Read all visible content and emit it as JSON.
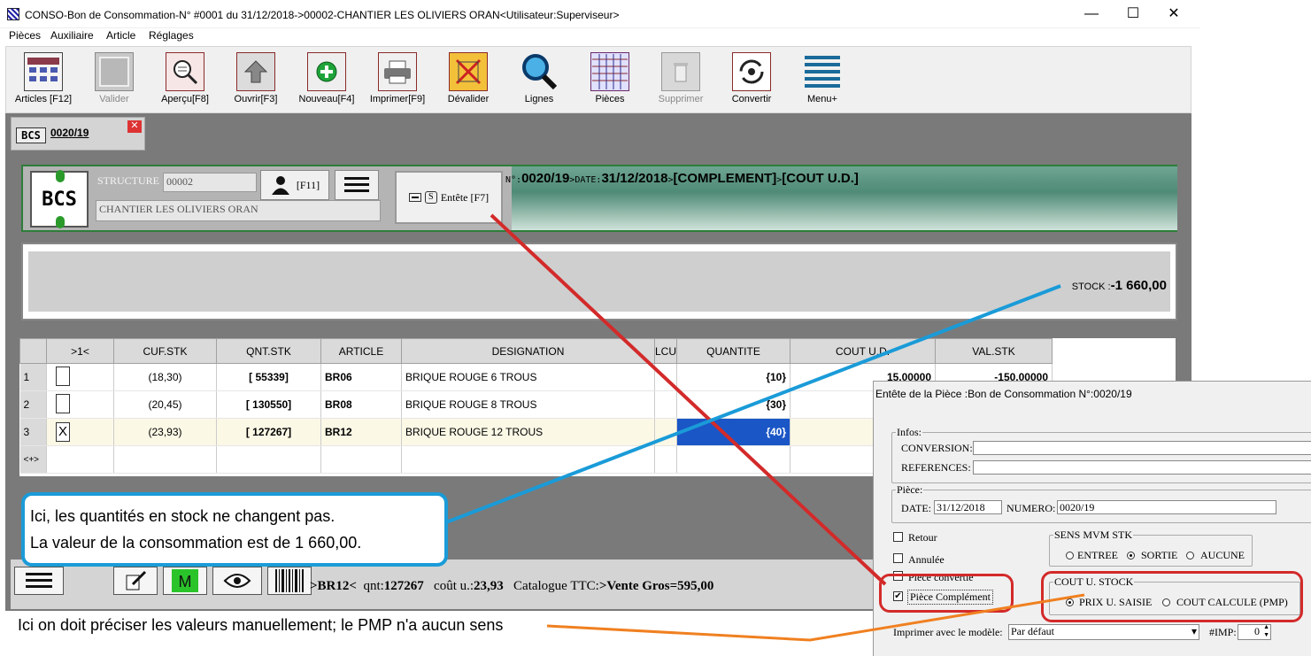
{
  "window": {
    "title": "CONSO-Bon de Consommation-N° #0001 du 31/12/2018->00002-CHANTIER LES OLIVIERS ORAN<Utilisateur:Superviseur>",
    "minimize": "—",
    "maximize": "☐",
    "close": "✕"
  },
  "menu": [
    "Pièces",
    "Auxiliaire",
    "Article",
    "Réglages"
  ],
  "toolbar": [
    {
      "label": "Articles [F12]",
      "icon": "articles-grid-icon",
      "enabled": true
    },
    {
      "label": "Valider",
      "icon": "validate-icon",
      "enabled": false
    },
    {
      "label": "Aperçu[F8]",
      "icon": "preview-magnifier-icon",
      "enabled": true
    },
    {
      "label": "Ouvrir[F3]",
      "icon": "open-arrow-icon",
      "enabled": true
    },
    {
      "label": "Nouveau[F4]",
      "icon": "new-plus-icon",
      "enabled": true
    },
    {
      "label": "Imprimer[F9]",
      "icon": "printer-icon",
      "enabled": true
    },
    {
      "label": "Dévalider",
      "icon": "devalidate-icon",
      "enabled": true
    },
    {
      "label": "Lignes",
      "icon": "lines-search-icon",
      "enabled": true
    },
    {
      "label": "Pièces",
      "icon": "pieces-grid-icon",
      "enabled": true
    },
    {
      "label": "Supprimer",
      "icon": "delete-bin-icon",
      "enabled": false
    },
    {
      "label": "Convertir",
      "icon": "convert-cycle-icon",
      "enabled": true
    },
    {
      "label": "Menu+",
      "icon": "menu-lines-icon",
      "enabled": true
    }
  ],
  "tab": {
    "code": "BCS",
    "title": "0020/19",
    "close": "✕"
  },
  "header": {
    "logo": "BCS",
    "structure_label": "STRUCTURE",
    "structure_code": "00002",
    "structure_name": "CHANTIER LES OLIVIERS ORAN",
    "user_key": "[F11]",
    "entete_icon": "S",
    "entete_label": "Entête [F7]",
    "no_label": "N°:",
    "no_value": "0020/19",
    "date_label": "DATE:",
    "date_value": "31/12/2018",
    "tag1": "[COMPLEMENT]",
    "tag2": "[COUT U.D.]"
  },
  "stock": {
    "label": "STOCK :",
    "value": "-1 660,00"
  },
  "grid": {
    "columns": [
      ">1<",
      "CUF.STK",
      "QNT.STK",
      "ARTICLE",
      "DESIGNATION",
      "LCU",
      "QUANTITE",
      "COUT U.D.",
      "VAL.STK"
    ],
    "rows": [
      {
        "n": "1",
        "mark": "",
        "cuf": "(18,30)",
        "qnt": "[ 55339]",
        "article": "BR06",
        "designation": "BRIQUE ROUGE 6 TROUS",
        "quantite": "{10}",
        "cout": "15,00000",
        "val": "-150,00000"
      },
      {
        "n": "2",
        "mark": "",
        "cuf": "(20,45)",
        "qnt": "[ 130550]",
        "article": "BR08",
        "designation": "BRIQUE ROUGE 8 TROUS",
        "quantite": "{30}",
        "cout": "",
        "val": ""
      },
      {
        "n": "3",
        "mark": "X",
        "cuf": "(23,93)",
        "qnt": "[ 127267]",
        "article": "BR12",
        "designation": "BRIQUE ROUGE 12 TROUS",
        "quantite": "{40}",
        "cout": "",
        "val": ""
      }
    ],
    "new_row": "<+>"
  },
  "annotations": {
    "blue_line1": "Ici, les quantités en stock   ne changent pas.",
    "blue_line2": "La valeur de la consommation est de 1 660,00.",
    "bottom_note": "Ici on doit préciser les valeurs manuellement; le PMP n'a aucun sens"
  },
  "status": {
    "article": ">BR12<",
    "qnt_label": "qnt:",
    "qnt": "127267",
    "cout_label": "coût u.:",
    "cout": "23,93",
    "catalogue": "Catalogue TTC:",
    "vente": ">Vente Gros=595,00"
  },
  "dialog": {
    "title": "Entête de la Pièce :Bon de Consommation N°:0020/19",
    "infos": "Infos:",
    "conversion": "CONVERSION:",
    "references": "REFERENCES:",
    "piece": "Pièce:",
    "date_label": "DATE:",
    "date": "31/12/2018",
    "numero_label": "NUMERO:",
    "numero": "0020/19",
    "retour": "Retour",
    "annulee": "Annulée",
    "convertie": "Pièce convertie",
    "complement": "Pièce Complément",
    "sens_title": "SENS MVM STK",
    "sens": [
      "ENTREE",
      "SORTIE",
      "AUCUNE"
    ],
    "cout_title": "COUT U. STOCK",
    "cout_opts": [
      "PRIX U. SAISIE",
      "COUT CALCULE (PMP)"
    ],
    "modele_label": "Imprimer avec le modèle:",
    "modele": "Par défaut",
    "imp_label": "#IMP:",
    "imp": "0"
  },
  "colors": {
    "annotation_red": "#d32a2a",
    "annotation_blue": "#1a9bd8",
    "annotation_orange": "#f08020",
    "header_green": "#2e7d3a"
  }
}
